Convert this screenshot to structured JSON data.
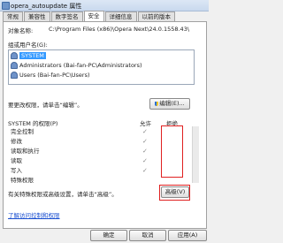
{
  "window": {
    "title": "opera_autoupdate 属性"
  },
  "tabs": [
    "常规",
    "兼容性",
    "数字签名",
    "安全",
    "详细信息",
    "以前的版本"
  ],
  "security": {
    "object_name_label": "对象名称:",
    "object_name_value": "C:\\Program Files (x86)\\Opera Next\\24.0.1558.43\\",
    "group_label": "组或用户名(G):",
    "principals": [
      {
        "name": "SYSTEM",
        "selected": true
      },
      {
        "name": "Administrators (Bai-fan-PC\\Administrators)",
        "selected": false
      },
      {
        "name": "Users (Bai-fan-PC\\Users)",
        "selected": false
      }
    ],
    "change_hint": "要更改权限，请单击“编辑”。",
    "edit_button": "编辑(E)...",
    "permissions_header": "SYSTEM 的权限(P)",
    "allow_header": "允许",
    "deny_header": "拒绝",
    "permissions": [
      {
        "name": "完全控制",
        "allow": "✓"
      },
      {
        "name": "修改",
        "allow": "✓"
      },
      {
        "name": "读取和执行",
        "allow": "✓"
      },
      {
        "name": "读取",
        "allow": "✓"
      },
      {
        "name": "写入",
        "allow": "✓"
      },
      {
        "name": "特殊权限",
        "allow": ""
      }
    ],
    "special_hint": "有关特殊权限或高级设置，请单击“高级”。",
    "advanced_button": "高级(V)",
    "learn_link": "了解访问控制和权限"
  },
  "footer": {
    "ok": "确定",
    "cancel": "取消",
    "apply": "应用(A)"
  },
  "colors": {
    "highlight": "#e02020",
    "selection": "#3399ff",
    "link": "#1a4fd0"
  }
}
